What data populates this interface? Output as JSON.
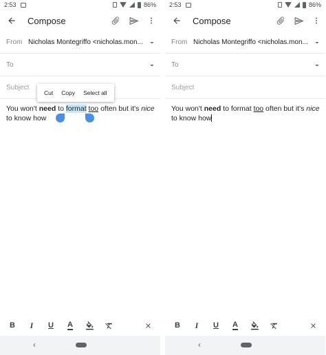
{
  "screens": [
    {
      "status": {
        "time": "2:53",
        "battery": "86%"
      },
      "app_bar": {
        "title": "Compose"
      },
      "fields": {
        "from_label": "From",
        "from_value": "Nicholas Montegriffo <nicholas.mon...",
        "to_label": "To",
        "subject_placeholder": "Subject"
      },
      "body": {
        "part1": "You won't ",
        "bold": "need",
        "part2": " to ",
        "selected": "format",
        "part3": " ",
        "underlined": "too",
        "part4": " often but it's ",
        "italic": "nice",
        "part5": " to know how"
      },
      "context_menu": {
        "cut": "Cut",
        "copy": "Copy",
        "select_all": "Select all"
      },
      "format_bar": {
        "bold": "B",
        "italic": "I",
        "underline": "U",
        "text_color": "A"
      },
      "nav": {
        "back": "‹"
      }
    },
    {
      "status": {
        "time": "2:53",
        "battery": "86%"
      },
      "app_bar": {
        "title": "Compose"
      },
      "fields": {
        "from_label": "From",
        "from_value": "Nicholas Montegriffo <nicholas.mon...",
        "to_label": "To",
        "subject_placeholder": "Subject"
      },
      "body": {
        "part1": "You won't ",
        "bold": "need",
        "part2": " to format ",
        "underlined": "too",
        "part4": " often but it's ",
        "italic": "nice",
        "part5": " to know how"
      },
      "format_bar": {
        "bold": "B",
        "italic": "I",
        "underline": "U",
        "text_color": "A"
      },
      "nav": {
        "back": "‹"
      }
    }
  ],
  "colors": {
    "accent": "#4a8fe7",
    "selection": "#c7e7f7",
    "divider": "#e8eaed"
  },
  "icons": [
    "back-arrow-icon",
    "attach-icon",
    "send-icon",
    "more-vert-icon",
    "chevron-down-icon",
    "fill-color-icon",
    "clear-format-icon",
    "close-icon"
  ]
}
